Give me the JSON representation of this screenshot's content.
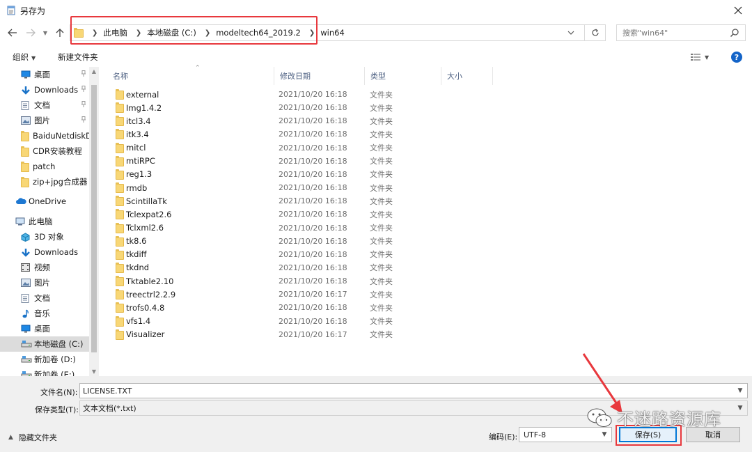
{
  "window": {
    "title": "另存为"
  },
  "address": {
    "crumbs": [
      "此电脑",
      "本地磁盘 (C:)",
      "modeltech64_2019.2",
      "win64"
    ]
  },
  "search": {
    "placeholder": "搜索\"win64\""
  },
  "toolbar": {
    "organize_label": "组织",
    "new_folder_label": "新建文件夹"
  },
  "nav": {
    "items": [
      {
        "label": "桌面",
        "icon": "desktop-icon",
        "pinned": true
      },
      {
        "label": "Downloads",
        "icon": "download-icon",
        "pinned": true
      },
      {
        "label": "文档",
        "icon": "document-icon",
        "pinned": true
      },
      {
        "label": "图片",
        "icon": "picture-icon",
        "pinned": true
      },
      {
        "label": "BaiduNetdiskD",
        "icon": "folder-icon"
      },
      {
        "label": "CDR安装教程",
        "icon": "folder-icon"
      },
      {
        "label": "patch",
        "icon": "folder-icon"
      },
      {
        "label": "zip+jpg合成器",
        "icon": "folder-icon"
      },
      {
        "label": "OneDrive",
        "icon": "cloud-icon"
      },
      {
        "label": "此电脑",
        "icon": "computer-icon"
      },
      {
        "label": "3D 对象",
        "icon": "cube-icon"
      },
      {
        "label": "Downloads",
        "icon": "download-icon"
      },
      {
        "label": "视频",
        "icon": "video-icon"
      },
      {
        "label": "图片",
        "icon": "picture-icon"
      },
      {
        "label": "文档",
        "icon": "document-icon"
      },
      {
        "label": "音乐",
        "icon": "music-icon"
      },
      {
        "label": "桌面",
        "icon": "desktop-icon"
      },
      {
        "label": "本地磁盘 (C:)",
        "icon": "drive-icon",
        "selected": true
      },
      {
        "label": "新加卷 (D:)",
        "icon": "drive-icon"
      },
      {
        "label": "新加卷 (E:)",
        "icon": "drive-icon"
      }
    ]
  },
  "list": {
    "columns": [
      "名称",
      "修改日期",
      "类型",
      "大小"
    ],
    "rows": [
      {
        "name": "external",
        "date": "2021/10/20 16:18",
        "type": "文件夹"
      },
      {
        "name": "Img1.4.2",
        "date": "2021/10/20 16:18",
        "type": "文件夹"
      },
      {
        "name": "itcl3.4",
        "date": "2021/10/20 16:18",
        "type": "文件夹"
      },
      {
        "name": "itk3.4",
        "date": "2021/10/20 16:18",
        "type": "文件夹"
      },
      {
        "name": "mitcl",
        "date": "2021/10/20 16:18",
        "type": "文件夹"
      },
      {
        "name": "mtiRPC",
        "date": "2021/10/20 16:18",
        "type": "文件夹"
      },
      {
        "name": "reg1.3",
        "date": "2021/10/20 16:18",
        "type": "文件夹"
      },
      {
        "name": "rmdb",
        "date": "2021/10/20 16:18",
        "type": "文件夹"
      },
      {
        "name": "ScintillaTk",
        "date": "2021/10/20 16:18",
        "type": "文件夹"
      },
      {
        "name": "Tclexpat2.6",
        "date": "2021/10/20 16:18",
        "type": "文件夹"
      },
      {
        "name": "Tclxml2.6",
        "date": "2021/10/20 16:18",
        "type": "文件夹"
      },
      {
        "name": "tk8.6",
        "date": "2021/10/20 16:18",
        "type": "文件夹"
      },
      {
        "name": "tkdiff",
        "date": "2021/10/20 16:18",
        "type": "文件夹"
      },
      {
        "name": "tkdnd",
        "date": "2021/10/20 16:18",
        "type": "文件夹"
      },
      {
        "name": "Tktable2.10",
        "date": "2021/10/20 16:18",
        "type": "文件夹"
      },
      {
        "name": "treectrl2.2.9",
        "date": "2021/10/20 16:17",
        "type": "文件夹"
      },
      {
        "name": "trofs0.4.8",
        "date": "2021/10/20 16:18",
        "type": "文件夹"
      },
      {
        "name": "vfs1.4",
        "date": "2021/10/20 16:18",
        "type": "文件夹"
      },
      {
        "name": "Visualizer",
        "date": "2021/10/20 16:17",
        "type": "文件夹"
      }
    ]
  },
  "bottom": {
    "filename_label": "文件名(N):",
    "filename_value": "LICENSE.TXT",
    "filetype_label": "保存类型(T):",
    "filetype_value": "文本文档(*.txt)",
    "hide_folders_label": "隐藏文件夹",
    "encoding_label": "编码(E):",
    "encoding_value": "UTF-8",
    "save_label": "保存(S)",
    "cancel_label": "取消"
  },
  "watermark": {
    "text": "不迷路资源库"
  },
  "colors": {
    "highlight": "#e8383d",
    "accent": "#0078d7",
    "folder": "#f8d776"
  }
}
